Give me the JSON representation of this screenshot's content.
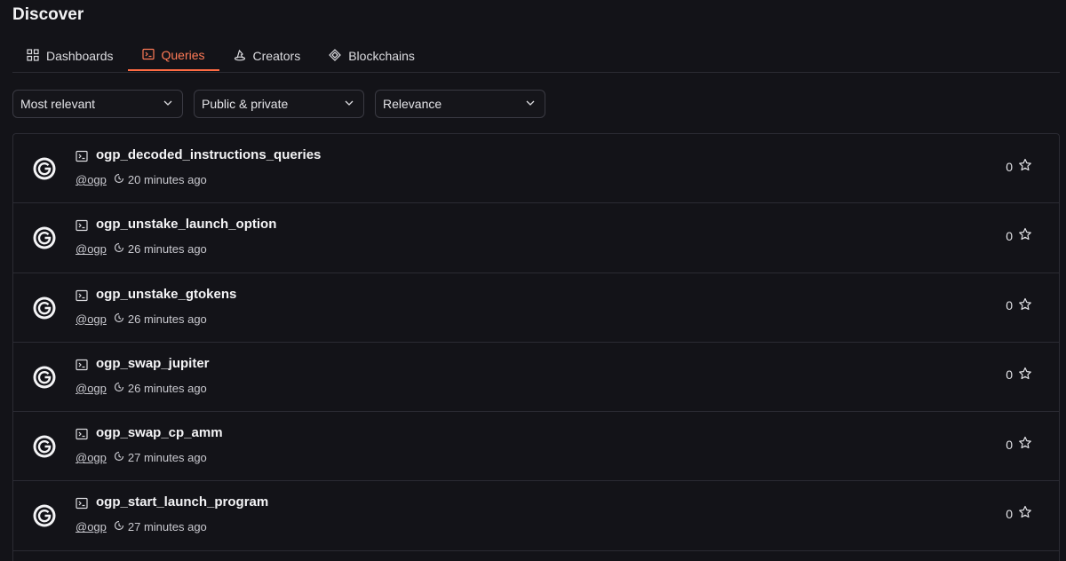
{
  "page": {
    "title": "Discover"
  },
  "tabs": [
    {
      "label": "Dashboards",
      "icon": "grid-icon",
      "active": false
    },
    {
      "label": "Queries",
      "icon": "terminal-icon",
      "active": true
    },
    {
      "label": "Creators",
      "icon": "wizard-hat-icon",
      "active": false
    },
    {
      "label": "Blockchains",
      "icon": "diamond-icon",
      "active": false
    }
  ],
  "filters": {
    "sort": {
      "value": "Most relevant"
    },
    "visibility": {
      "value": "Public & private"
    },
    "order": {
      "value": "Relevance"
    }
  },
  "queries": [
    {
      "title": "ogp_decoded_instructions_queries",
      "author": "@ogp",
      "time": "20 minutes ago",
      "stars": "0"
    },
    {
      "title": "ogp_unstake_launch_option",
      "author": "@ogp",
      "time": "26 minutes ago",
      "stars": "0"
    },
    {
      "title": "ogp_unstake_gtokens",
      "author": "@ogp",
      "time": "26 minutes ago",
      "stars": "0"
    },
    {
      "title": "ogp_swap_jupiter",
      "author": "@ogp",
      "time": "26 minutes ago",
      "stars": "0"
    },
    {
      "title": "ogp_swap_cp_amm",
      "author": "@ogp",
      "time": "27 minutes ago",
      "stars": "0"
    },
    {
      "title": "ogp_start_launch_program",
      "author": "@ogp",
      "time": "27 minutes ago",
      "stars": "0"
    }
  ],
  "colors": {
    "accent": "#ff6b43",
    "background": "#131318",
    "border": "#2b2b33"
  }
}
